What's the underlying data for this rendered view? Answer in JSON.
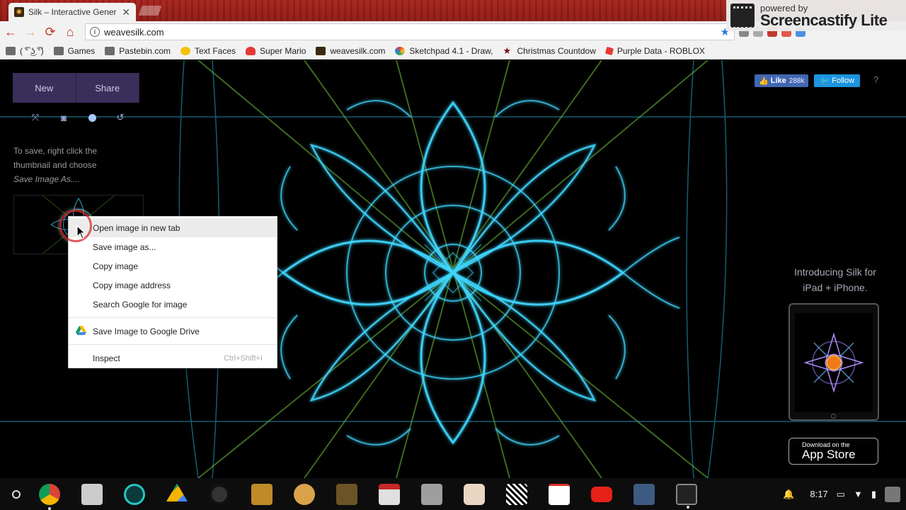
{
  "browser": {
    "tab_title": "Silk – Interactive Genera",
    "tab_close": "✕",
    "url": "weavesilk.com",
    "nav": {
      "back": "←",
      "forward": "→",
      "reload": "⟳",
      "home": "⌂",
      "star": "★"
    },
    "bookmarks": [
      {
        "label": "( ͡° ͜ʖ ͡°)",
        "icon": "folder-icon"
      },
      {
        "label": "Games",
        "icon": "folder-icon"
      },
      {
        "label": "Pastebin.com",
        "icon": "folder-icon"
      },
      {
        "label": "Text Faces",
        "icon": "smiley-icon"
      },
      {
        "label": "Super Mario",
        "icon": "mushroom-icon"
      },
      {
        "label": "weavesilk.com",
        "icon": "silk-icon"
      },
      {
        "label": "Sketchpad 4.1 - Draw,",
        "icon": "sketchpad-icon"
      },
      {
        "label": "Christmas Countdow",
        "icon": "star-icon"
      },
      {
        "label": "Purple Data - ROBLOX",
        "icon": "roblox-icon"
      }
    ]
  },
  "screencastify": {
    "line1": "powered by",
    "line2": "Screencastify Lite"
  },
  "silk": {
    "new_label": "New",
    "share_label": "Share",
    "save_line1": "To save, right click the",
    "save_line2": "thumbnail and choose",
    "save_line3": "Save Image As....",
    "fb_like": "Like",
    "fb_count": "288k",
    "tw_follow": "Follow",
    "help": "?",
    "intro_line1": "Introducing Silk for",
    "intro_line2": "iPad + iPhone.",
    "appstore_line1": "Download on the",
    "appstore_line2": "App Store"
  },
  "context_menu": {
    "items": [
      {
        "label": "Open image in new tab"
      },
      {
        "label": "Save image as..."
      },
      {
        "label": "Copy image"
      },
      {
        "label": "Copy image address"
      },
      {
        "label": "Search Google for image"
      },
      {
        "label": "Save Image to Google Drive"
      },
      {
        "label": "Inspect",
        "shortcut": "Ctrl+Shift+I"
      }
    ]
  },
  "shelf": {
    "time": "8:17",
    "apps": [
      "chrome-icon",
      "store-icon",
      "settings-icon",
      "drive-icon",
      "music-icon",
      "chest-icon",
      "doge-icon",
      "scarecrow-icon",
      "gift-icon",
      "tetris-icon",
      "face-icon",
      "qr-icon",
      "gmail-icon",
      "youtube-icon",
      "calculator-icon",
      "film-icon"
    ]
  },
  "colors": {
    "accent_cyan": "#3fd7ff",
    "accent_green": "#7fd13a",
    "silk_button": "#3a2f5a",
    "tab_bg": "#a5221b"
  }
}
